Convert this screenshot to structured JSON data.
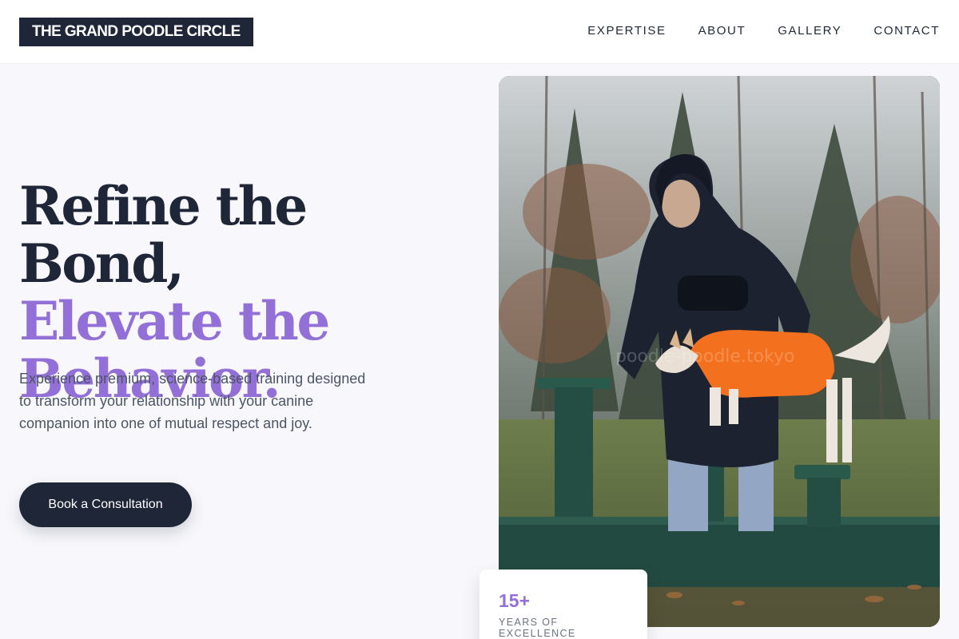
{
  "brand": {
    "logo_text": "THE GRAND POODLE CIRCLE"
  },
  "nav": {
    "items": [
      "EXPERTISE",
      "ABOUT",
      "GALLERY",
      "CONTACT"
    ]
  },
  "hero": {
    "headline_line1": "Refine the Bond,",
    "headline_line2": "Elevate the",
    "headline_line3": "Behavior.",
    "description": "Experience premium, science-based training designed to transform your relationship with your canine companion into one of mutual respect and joy.",
    "cta_label": "Book a Consultation"
  },
  "photo": {
    "watermark": "poodle-poodle.tokyo"
  },
  "stat": {
    "value": "15+",
    "label": "YEARS OF EXCELLENCE"
  },
  "colors": {
    "navy": "#1e2638",
    "accent_purple": "#9370d8",
    "background": "#f8f8fc"
  },
  "icons": []
}
